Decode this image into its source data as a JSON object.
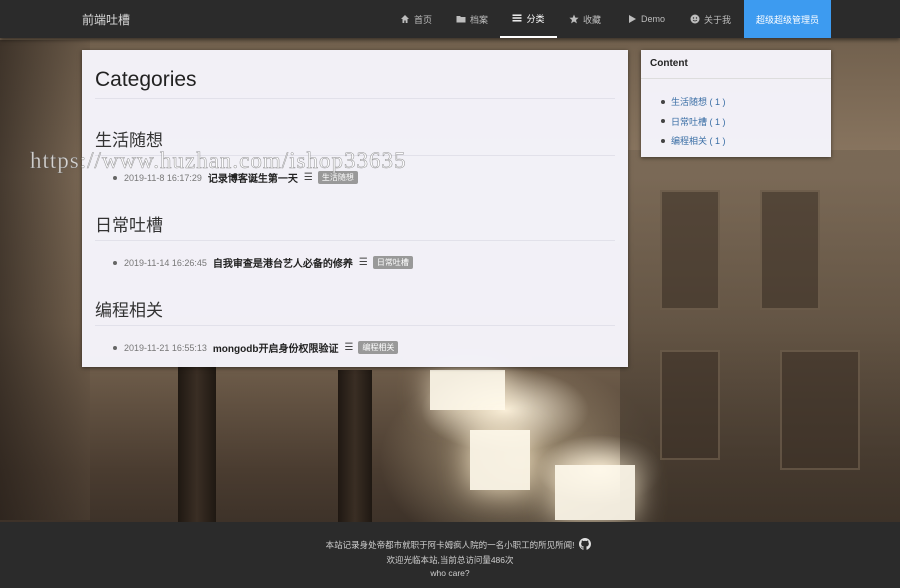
{
  "nav": {
    "brand": "前端吐槽",
    "items": [
      {
        "label": "首页",
        "icon": "home-icon"
      },
      {
        "label": "档案",
        "icon": "folder-icon"
      },
      {
        "label": "分类",
        "icon": "list-icon",
        "active": true
      },
      {
        "label": "收藏",
        "icon": "star-icon"
      },
      {
        "label": "Demo",
        "icon": "play-icon"
      },
      {
        "label": "关于我",
        "icon": "smile-icon"
      }
    ],
    "admin_label": "超级超级管理员"
  },
  "main": {
    "title": "Categories",
    "categories": [
      {
        "name": "生活随想",
        "post": {
          "date": "2019-11-8 16:17:29",
          "title": "记录博客诞生第一天",
          "tag": "生活随想"
        }
      },
      {
        "name": "日常吐槽",
        "post": {
          "date": "2019-11-14 16:26:45",
          "title": "自我审查是港台艺人必备的修养",
          "tag": "日常吐槽"
        }
      },
      {
        "name": "编程相关",
        "post": {
          "date": "2019-11-21 16:55:13",
          "title": "mongodb开启身份权限验证",
          "tag": "编程相关"
        }
      }
    ]
  },
  "sidebar": {
    "title": "Content",
    "items": [
      "生活随想 ( 1 )",
      "日常吐槽 ( 1 )",
      "编程相关 ( 1 )"
    ]
  },
  "watermark": "https://www.huzhan.com/ishop33635",
  "footer": {
    "line1": "本站记录身处帝都市就职于阿卡姆疯人院的一名小职工的所见所闻!",
    "line2": "欢迎光临本站,当前总访问量486次",
    "line3": "who care?"
  },
  "colors": {
    "accent": "#3d9bf0",
    "nav_bg": "#2b2b2b",
    "tag_bg": "#999999"
  }
}
